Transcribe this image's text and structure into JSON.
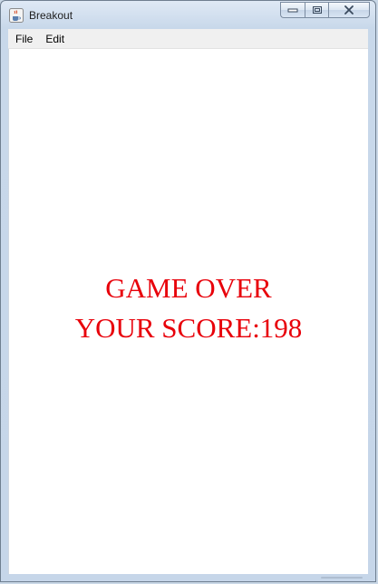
{
  "window": {
    "title": "Breakout"
  },
  "menubar": {
    "items": [
      {
        "label": "File"
      },
      {
        "label": "Edit"
      }
    ]
  },
  "game": {
    "status_text": "GAME OVER",
    "score_label": "YOUR SCORE:",
    "score": 198,
    "score_text": "YOUR SCORE:198",
    "text_color": "#e8000a",
    "background_color": "#ffffff"
  },
  "icons": {
    "app": "java-cup-icon",
    "minimize": "minimize-icon",
    "maximize": "maximize-icon",
    "close": "close-icon"
  }
}
